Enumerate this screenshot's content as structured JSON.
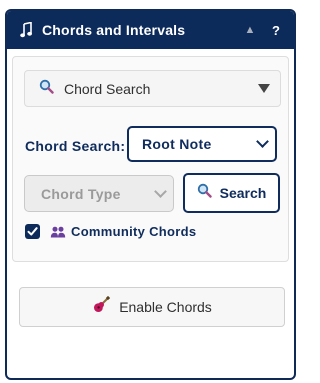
{
  "header": {
    "title": "Chords and Intervals",
    "icon": "music-note-icon",
    "collapse_glyph": "▲",
    "help_label": "?"
  },
  "search_toggle": {
    "icon": "search-icon",
    "label": "Chord Search"
  },
  "chord_search": {
    "label": "Chord Search:",
    "root_select_value": "Root Note",
    "type_select_placeholder": "Chord Type",
    "type_select_disabled": true,
    "search_button_label": "Search",
    "search_button_icon": "search-icon"
  },
  "community": {
    "checked": true,
    "icon": "people-icon",
    "label": "Community Chords"
  },
  "enable": {
    "icon": "guitar-icon",
    "label": "Enable Chords"
  },
  "colors": {
    "primary": "#0d2b5a",
    "accent_pink": "#c2185b",
    "people_purple": "#6a3fa0",
    "disabled_bg": "#ececec"
  }
}
